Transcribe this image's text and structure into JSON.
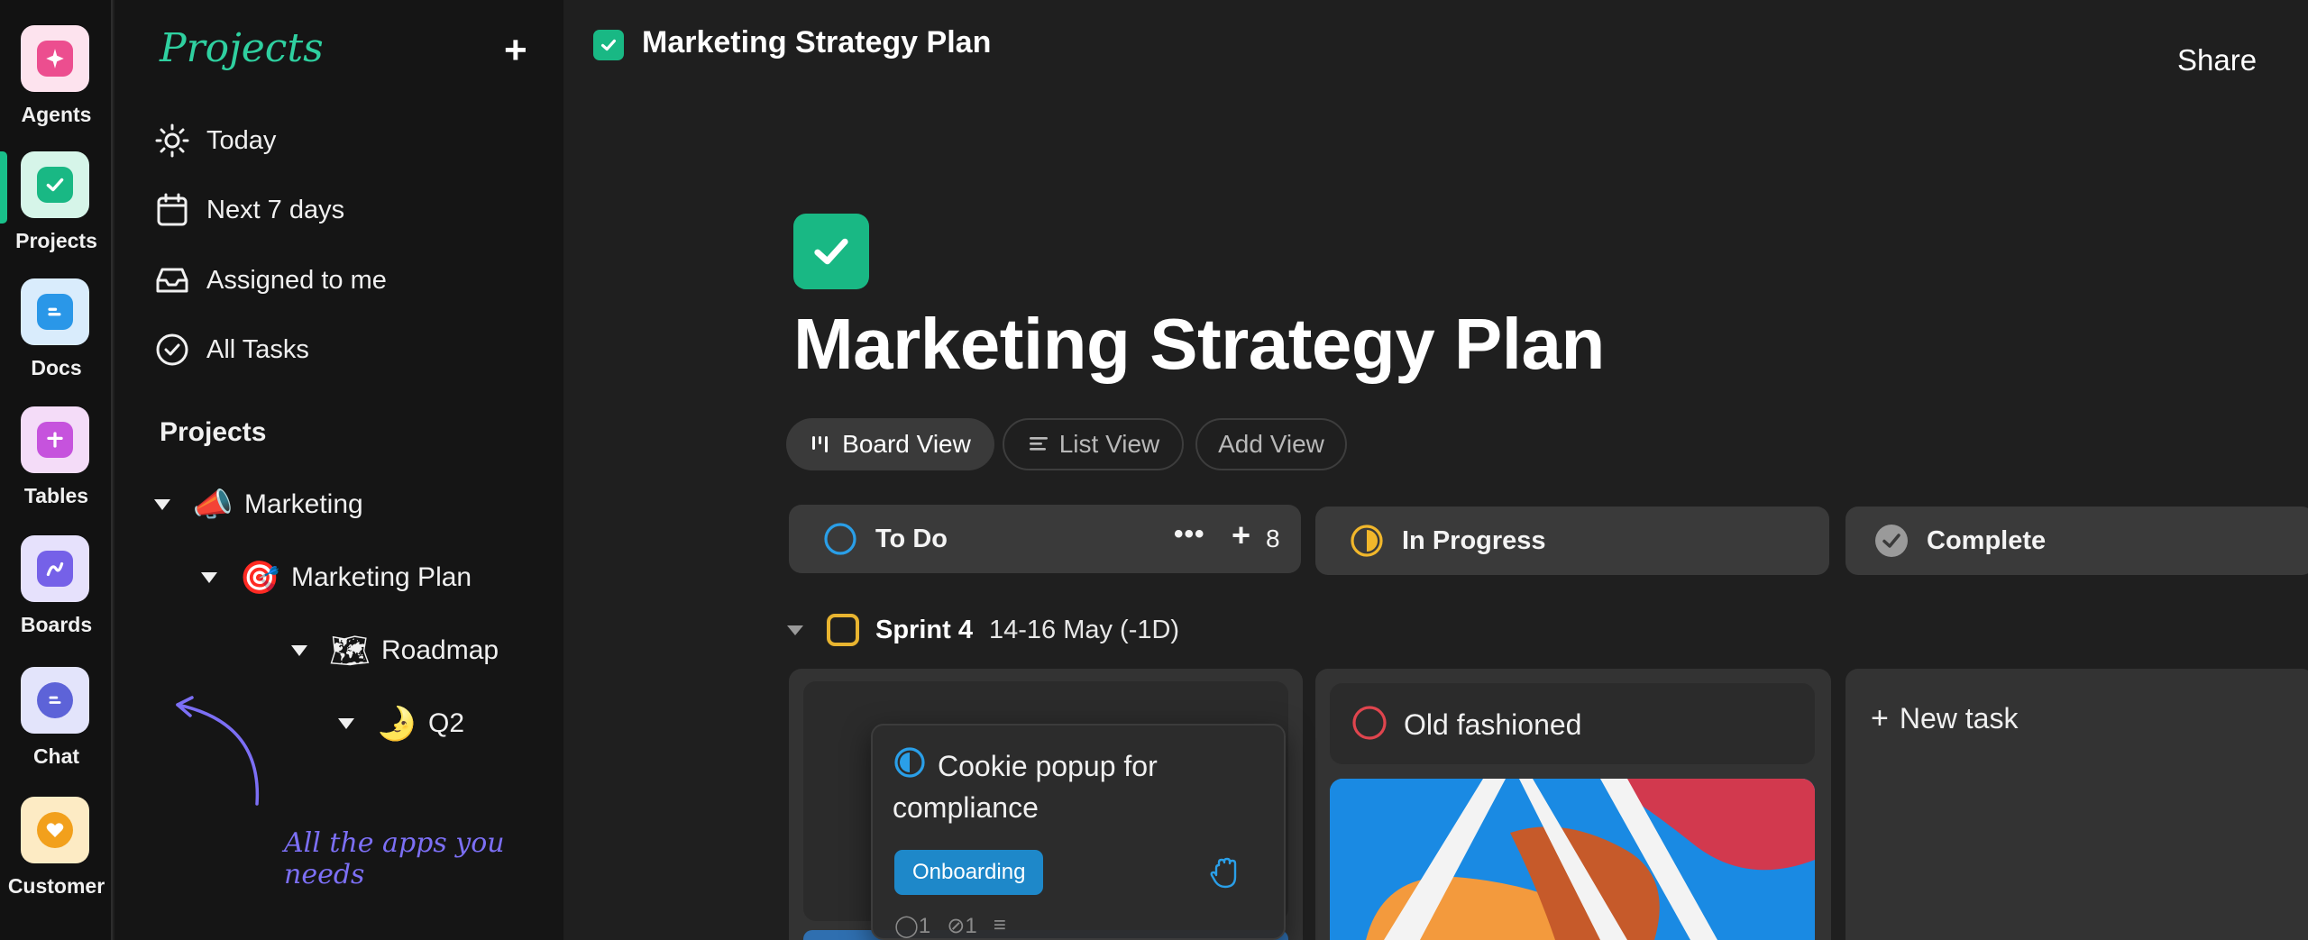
{
  "rail": {
    "items": [
      {
        "label": "Agents",
        "icon": "sparkles-icon"
      },
      {
        "label": "Projects",
        "icon": "check-icon"
      },
      {
        "label": "Docs",
        "icon": "document-icon"
      },
      {
        "label": "Tables",
        "icon": "plus-table-icon"
      },
      {
        "label": "Boards",
        "icon": "brush-icon"
      },
      {
        "label": "Chat",
        "icon": "chat-bubble-icon"
      },
      {
        "label": "Customer",
        "icon": "heart-icon"
      }
    ],
    "active": "Projects"
  },
  "sidebar": {
    "title": "Projects",
    "nav": [
      {
        "label": "Today",
        "icon": "sun-icon"
      },
      {
        "label": "Next 7 days",
        "icon": "calendar-icon"
      },
      {
        "label": "Assigned to me",
        "icon": "inbox-icon"
      },
      {
        "label": "All Tasks",
        "icon": "check-circle-icon"
      }
    ],
    "section_title": "Projects",
    "tree": [
      {
        "label": "Marketing",
        "emoji": "📣"
      },
      {
        "label": "Marketing Plan",
        "emoji": "🎯"
      },
      {
        "label": "Roadmap",
        "emoji": "🗺"
      },
      {
        "label": "Q2",
        "emoji": "🌛"
      }
    ],
    "annotation": "All the apps you needs"
  },
  "header": {
    "title": "Marketing Strategy Plan",
    "share_label": "Share"
  },
  "page": {
    "title": "Marketing Strategy Plan",
    "views": [
      {
        "label": "Board View",
        "icon": "board-icon",
        "active": true
      },
      {
        "label": "List View",
        "icon": "list-icon",
        "active": false
      },
      {
        "label": "Add View",
        "icon": "",
        "active": false
      }
    ]
  },
  "board": {
    "columns": [
      {
        "label": "To Do",
        "count": "8"
      },
      {
        "label": "In Progress"
      },
      {
        "label": "Complete"
      }
    ],
    "sprint": {
      "name": "Sprint 4",
      "dates": "14-16 May (-1D)"
    },
    "cards": {
      "cookie": {
        "title": "Cookie popup for compliance",
        "tag": "Onboarding",
        "comments": "1",
        "attachments": "1"
      },
      "old_fashioned": {
        "title": "Old fashioned"
      }
    },
    "new_task_label": "New task"
  },
  "colors": {
    "accent_green": "#19b884",
    "tag_blue": "#1e88c9",
    "annotation_purple": "#7c6ff5",
    "title_teal": "#2fd0a0"
  }
}
